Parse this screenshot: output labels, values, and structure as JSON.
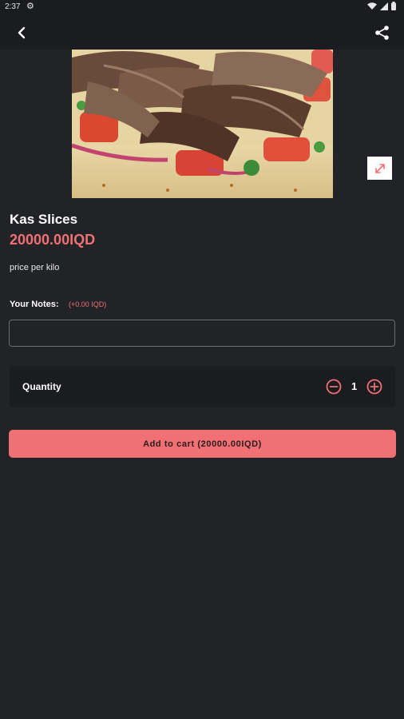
{
  "status_bar": {
    "time": "2:37"
  },
  "product": {
    "name": "Kas Slices",
    "price": "20000.00IQD",
    "description": "price per kilo"
  },
  "notes": {
    "label": "Your Notes:",
    "extra_price": "(+0.00 IQD)",
    "value": ""
  },
  "quantity": {
    "label": "Quantity",
    "value": "1"
  },
  "cart": {
    "button_label": "Add to cart (20000.00IQD)"
  },
  "colors": {
    "accent": "#f07074",
    "background": "#222327",
    "surface": "#1b1c1f"
  },
  "icons": [
    "back-arrow-icon",
    "share-icon",
    "expand-icon",
    "minus-circle-icon",
    "plus-circle-icon",
    "wifi-icon",
    "signal-icon",
    "battery-icon",
    "settings-icon"
  ]
}
